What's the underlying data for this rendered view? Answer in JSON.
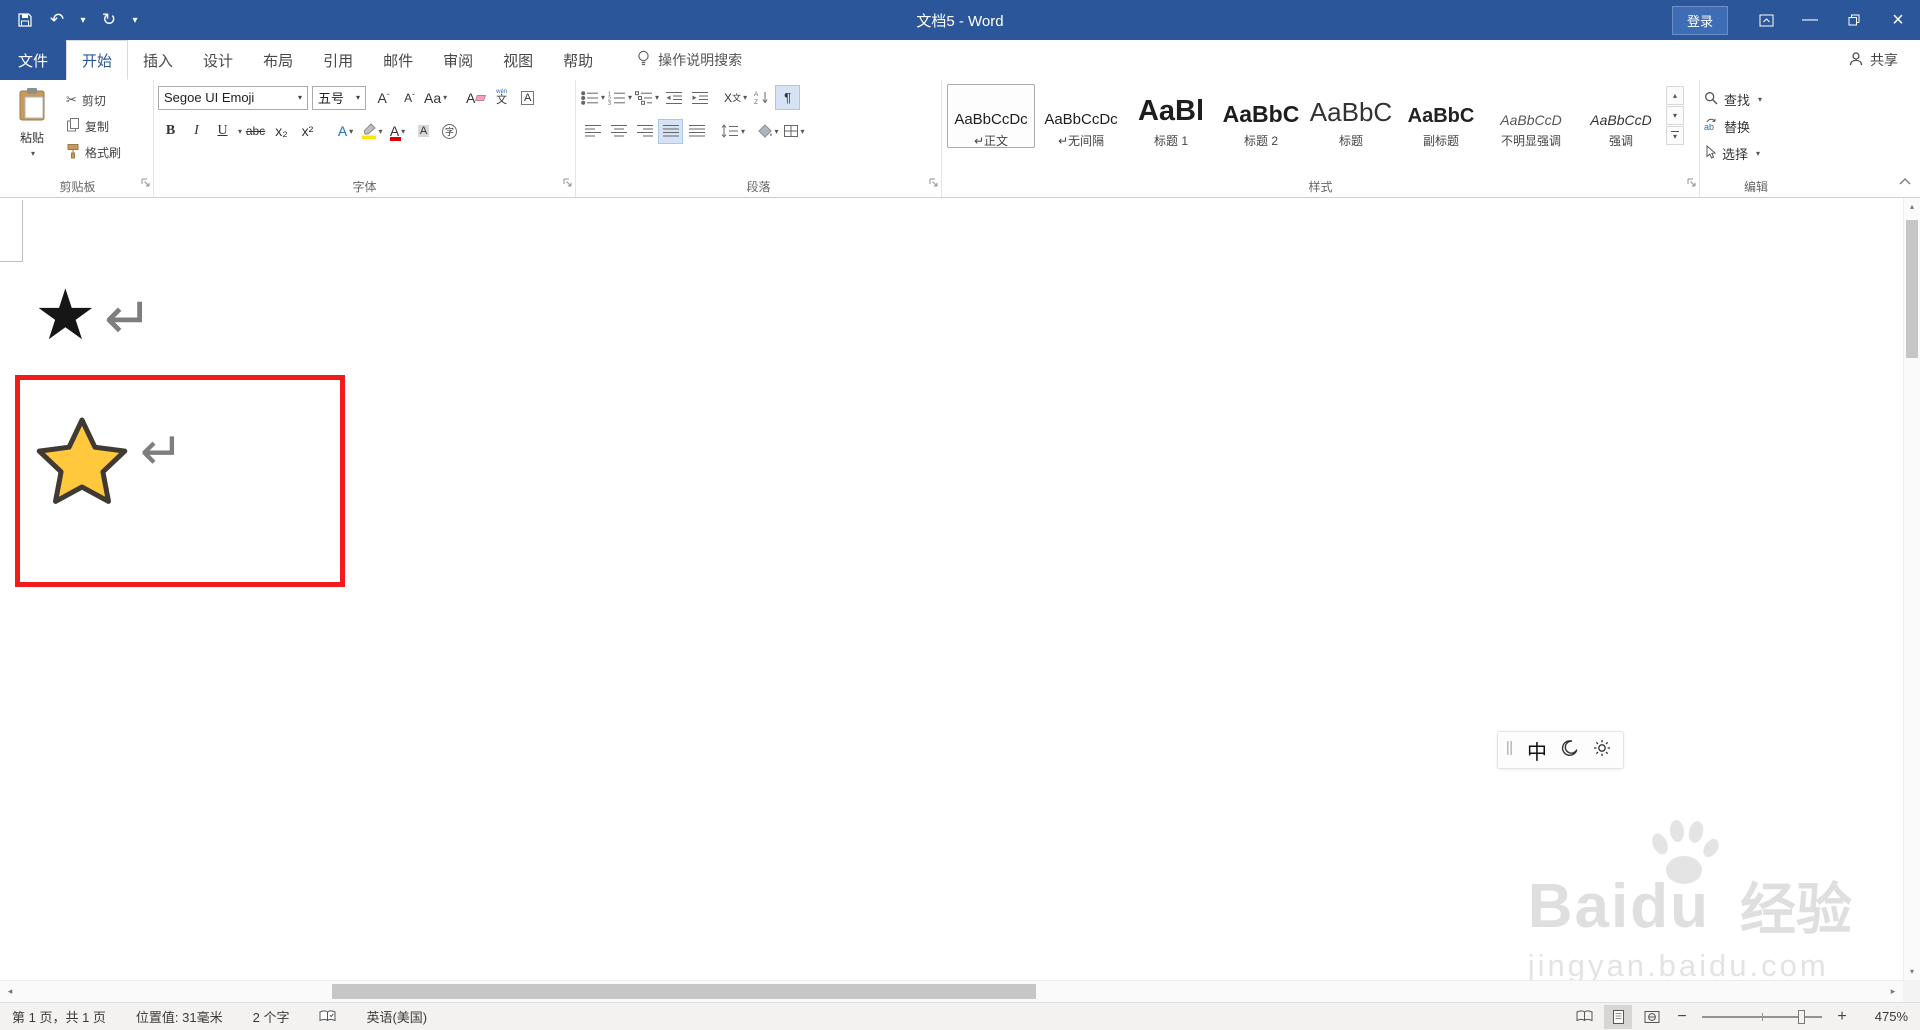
{
  "window": {
    "title": "文档5 - Word",
    "login_label": "登录"
  },
  "ribbon": {
    "tabs": [
      "文件",
      "开始",
      "插入",
      "设计",
      "布局",
      "引用",
      "邮件",
      "审阅",
      "视图",
      "帮助"
    ],
    "active_tab": "开始",
    "tell_me": "操作说明搜索",
    "share_label": "共享",
    "groups": {
      "clipboard": {
        "label": "剪贴板",
        "paste": "粘贴",
        "cut": "剪切",
        "copy": "复制",
        "format_painter": "格式刷"
      },
      "font": {
        "label": "字体",
        "name_value": "Segoe UI Emoji",
        "size_value": "五号",
        "bold": "B",
        "italic": "I",
        "underline": "U",
        "strikethrough": "abc",
        "subscript": "x₂",
        "superscript": "x²"
      },
      "paragraph": {
        "label": "段落"
      },
      "styles": {
        "label": "样式",
        "items": [
          {
            "preview": "AaBbCcDc",
            "name": "↵正文"
          },
          {
            "preview": "AaBbCcDc",
            "name": "↵无间隔"
          },
          {
            "preview": "AaBl",
            "name": "标题 1"
          },
          {
            "preview": "AaBbC",
            "name": "标题 2"
          },
          {
            "preview": "AaBbC",
            "name": "标题"
          },
          {
            "preview": "AaBbC",
            "name": "副标题"
          },
          {
            "preview": "AaBbCcD",
            "name": "不明显强调"
          },
          {
            "preview": "AaBbCcD",
            "name": "强调"
          }
        ]
      },
      "editing": {
        "label": "编辑",
        "find": "查找",
        "replace": "替换",
        "select": "选择"
      }
    }
  },
  "document": {
    "black_star_glyph": "★",
    "paragraph_mark": "↵",
    "yellow_star": {
      "fill": "#FFC83D",
      "outline": "#403A33"
    },
    "annotation_color": "#F21B1B"
  },
  "ime_bar": {
    "mode_label": "中"
  },
  "watermark": {
    "brand": "Baidu",
    "suffix": "经验",
    "url": "jingyan.baidu.com"
  },
  "statusbar": {
    "page_info": "第 1 页，共 1 页",
    "position": "位置值: 31毫米",
    "word_count": "2 个字",
    "language": "英语(美国)",
    "zoom_level": "475%"
  },
  "colors": {
    "titlebar": "#2B579A",
    "highlight_yellow": "#FFE400",
    "font_color_red": "#E00000",
    "annotation_red": "#F21B1B",
    "watermark_gray": "#DFDFDF"
  }
}
